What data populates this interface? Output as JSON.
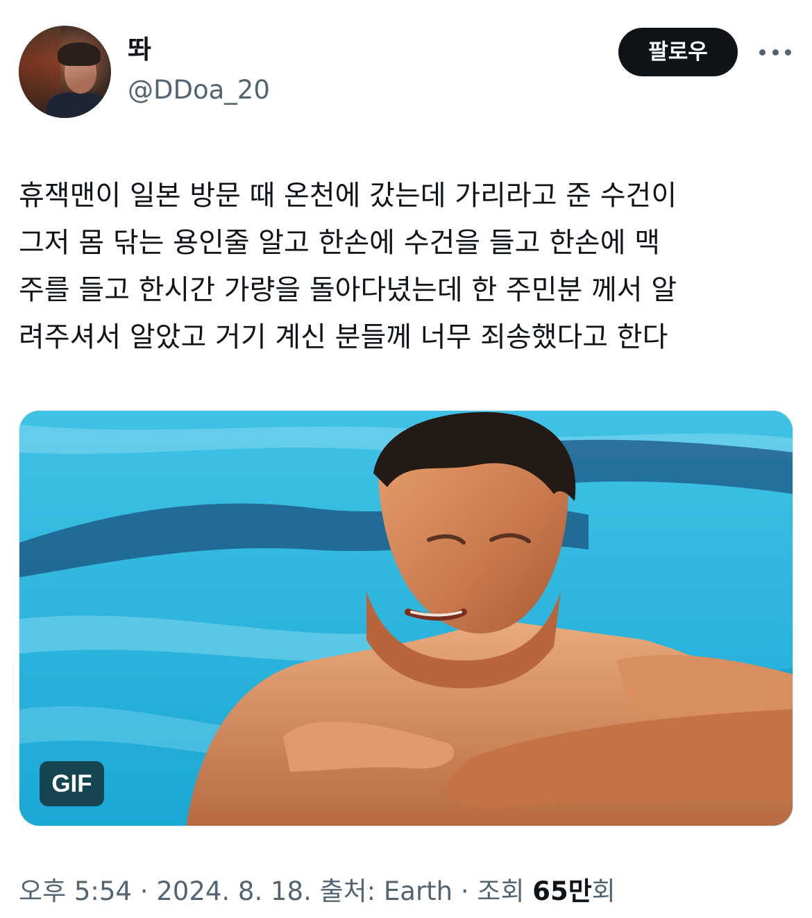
{
  "user": {
    "display_name": "똬",
    "handle": "@DDoa_20",
    "avatar_icon": "profile-photo"
  },
  "header": {
    "follow_label": "팔로우",
    "more_icon": "more-horizontal-icon"
  },
  "tweet": {
    "text_lines": [
      "휴잭맨이 일본 방문 때 온천에 갔는데 가리라고 준 수건이",
      "그저 몸 닦는 용인줄 알고 한손에 수건을 들고 한손에 맥",
      "주를 들고 한시간 가량을 돌아다녔는데 한 주민분 께서 알",
      "려주셔서 알았고 거기 계신 분들께 너무 죄송했다고 한다"
    ]
  },
  "media": {
    "type_badge": "GIF",
    "description_icon": "gif-man-in-pool"
  },
  "meta": {
    "time": "오후 5:54",
    "separator": " · ",
    "date": "2024. 8. 18.",
    "source_label": "출처: Earth",
    "views_prefix": "조회 ",
    "views_count": "65만",
    "views_suffix": "회"
  },
  "colors": {
    "text_primary": "#0f1419",
    "text_secondary": "#536471",
    "button_bg": "#0f1419",
    "pool_blue": "#2fb6dc"
  }
}
